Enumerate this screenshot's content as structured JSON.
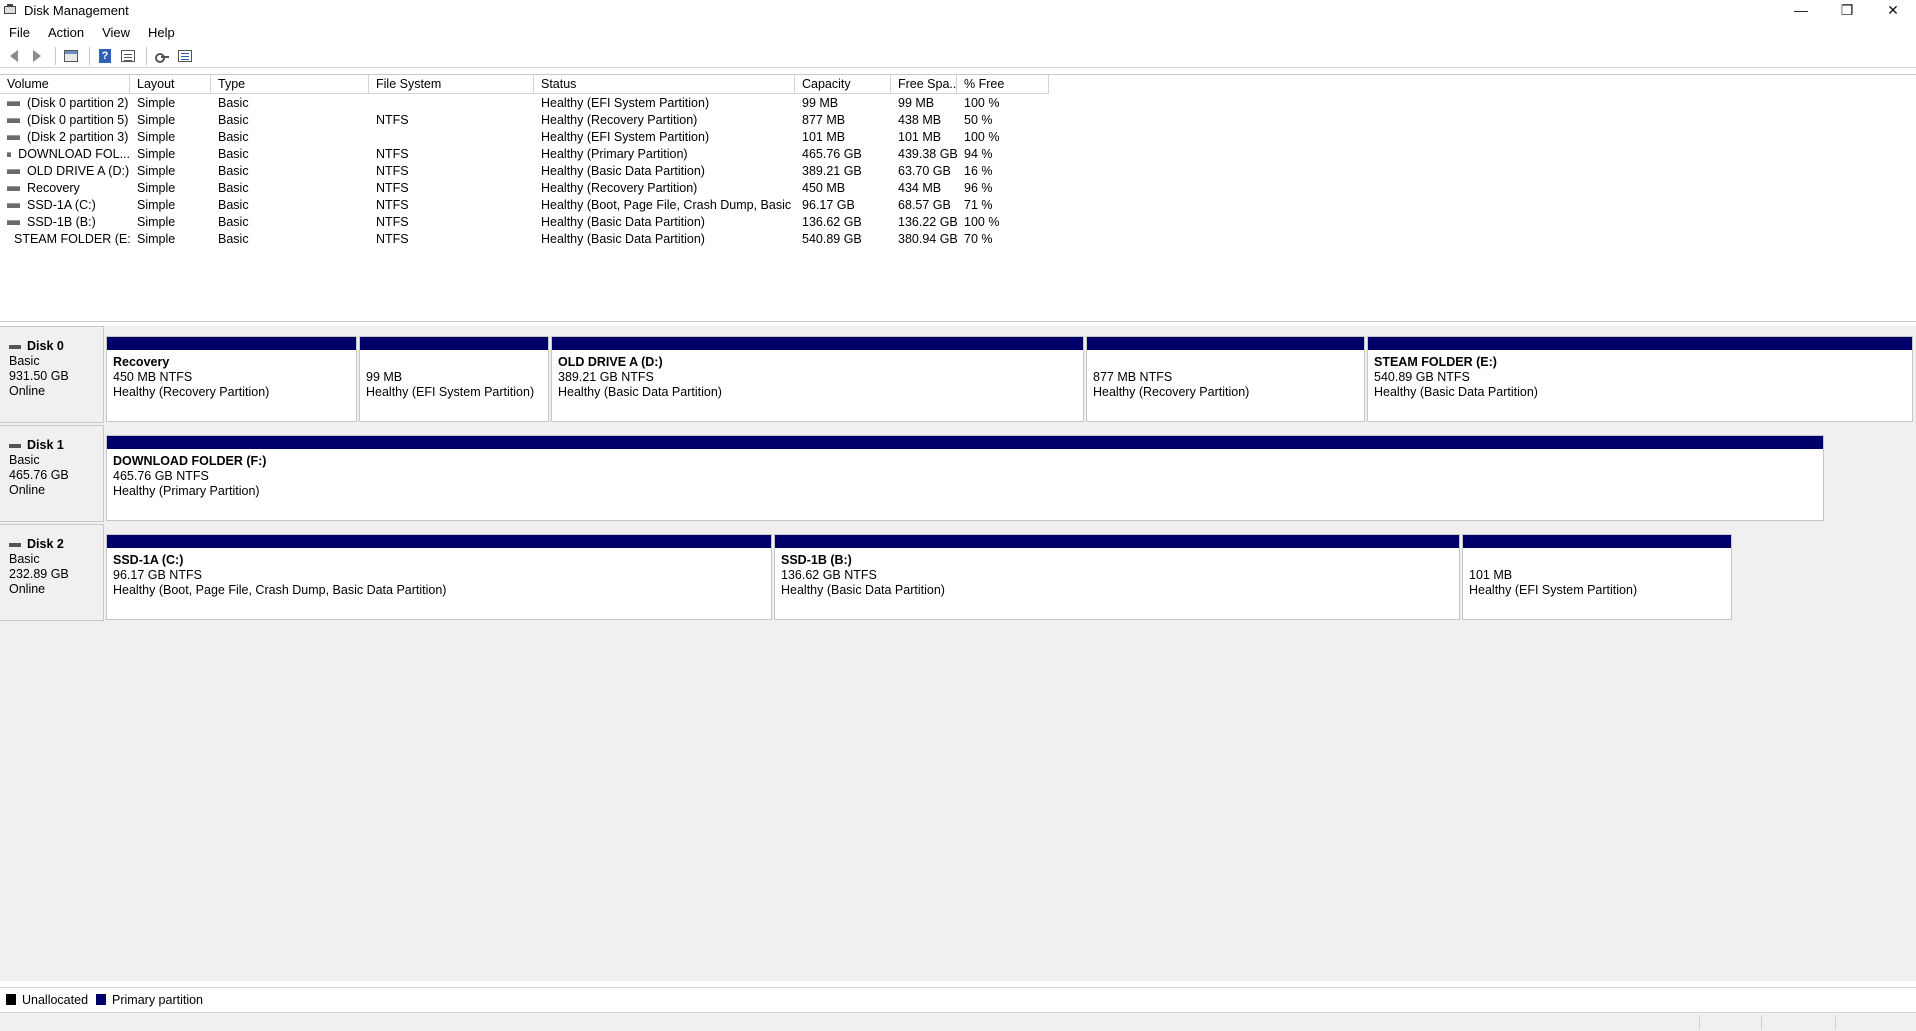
{
  "window": {
    "title": "Disk Management",
    "controls": {
      "minimize": "—",
      "restore": "❐",
      "close": "✕"
    }
  },
  "menu": [
    "File",
    "Action",
    "View",
    "Help"
  ],
  "toolbar": {
    "icons": [
      "back-icon",
      "forward-icon",
      "console-tree-icon",
      "help-icon",
      "properties-icon",
      "rescan-icon",
      "list-view-icon"
    ]
  },
  "volumes": {
    "columns": [
      "Volume",
      "Layout",
      "Type",
      "File System",
      "Status",
      "Capacity",
      "Free Spa...",
      "% Free"
    ],
    "rows": [
      [
        "(Disk 0 partition 2)",
        "Simple",
        "Basic",
        "",
        "Healthy (EFI System Partition)",
        "99 MB",
        "99 MB",
        "100 %"
      ],
      [
        "(Disk 0 partition 5)",
        "Simple",
        "Basic",
        "NTFS",
        "Healthy (Recovery Partition)",
        "877 MB",
        "438 MB",
        "50 %"
      ],
      [
        "(Disk 2 partition 3)",
        "Simple",
        "Basic",
        "",
        "Healthy (EFI System Partition)",
        "101 MB",
        "101 MB",
        "100 %"
      ],
      [
        "DOWNLOAD FOL...",
        "Simple",
        "Basic",
        "NTFS",
        "Healthy (Primary Partition)",
        "465.76 GB",
        "439.38 GB",
        "94 %"
      ],
      [
        "OLD DRIVE A (D:)",
        "Simple",
        "Basic",
        "NTFS",
        "Healthy (Basic Data Partition)",
        "389.21 GB",
        "63.70 GB",
        "16 %"
      ],
      [
        "Recovery",
        "Simple",
        "Basic",
        "NTFS",
        "Healthy (Recovery Partition)",
        "450 MB",
        "434 MB",
        "96 %"
      ],
      [
        "SSD-1A (C:)",
        "Simple",
        "Basic",
        "NTFS",
        "Healthy (Boot, Page File, Crash Dump, Basic ...",
        "96.17 GB",
        "68.57 GB",
        "71 %"
      ],
      [
        "SSD-1B (B:)",
        "Simple",
        "Basic",
        "NTFS",
        "Healthy (Basic Data Partition)",
        "136.62 GB",
        "136.22 GB",
        "100 %"
      ],
      [
        "STEAM FOLDER (E:)",
        "Simple",
        "Basic",
        "NTFS",
        "Healthy (Basic Data Partition)",
        "540.89 GB",
        "380.94 GB",
        "70 %"
      ]
    ]
  },
  "disks": [
    {
      "name": "Disk 0",
      "type": "Basic",
      "size": "931.50 GB",
      "state": "Online",
      "partitions": [
        {
          "name": "Recovery",
          "size": "450 MB NTFS",
          "status": "Healthy (Recovery Partition)"
        },
        {
          "name": "",
          "size": "99 MB",
          "status": "Healthy (EFI System Partition)"
        },
        {
          "name": "OLD DRIVE A  (D:)",
          "size": "389.21 GB NTFS",
          "status": "Healthy (Basic Data Partition)"
        },
        {
          "name": "",
          "size": "877 MB NTFS",
          "status": "Healthy (Recovery Partition)"
        },
        {
          "name": "STEAM FOLDER  (E:)",
          "size": "540.89 GB NTFS",
          "status": "Healthy (Basic Data Partition)"
        }
      ]
    },
    {
      "name": "Disk 1",
      "type": "Basic",
      "size": "465.76 GB",
      "state": "Online",
      "partitions": [
        {
          "name": "DOWNLOAD FOLDER  (F:)",
          "size": "465.76 GB NTFS",
          "status": "Healthy (Primary Partition)"
        }
      ]
    },
    {
      "name": "Disk 2",
      "type": "Basic",
      "size": "232.89 GB",
      "state": "Online",
      "partitions": [
        {
          "name": "SSD-1A  (C:)",
          "size": "96.17 GB NTFS",
          "status": "Healthy (Boot, Page File, Crash Dump, Basic Data Partition)"
        },
        {
          "name": "SSD-1B  (B:)",
          "size": "136.62 GB NTFS",
          "status": "Healthy (Basic Data Partition)"
        },
        {
          "name": "",
          "size": "101 MB",
          "status": "Healthy (EFI System Partition)"
        }
      ]
    }
  ],
  "legend": [
    {
      "label": "Unallocated",
      "color": "#000000"
    },
    {
      "label": "Primary partition",
      "color": "#00006a"
    }
  ]
}
